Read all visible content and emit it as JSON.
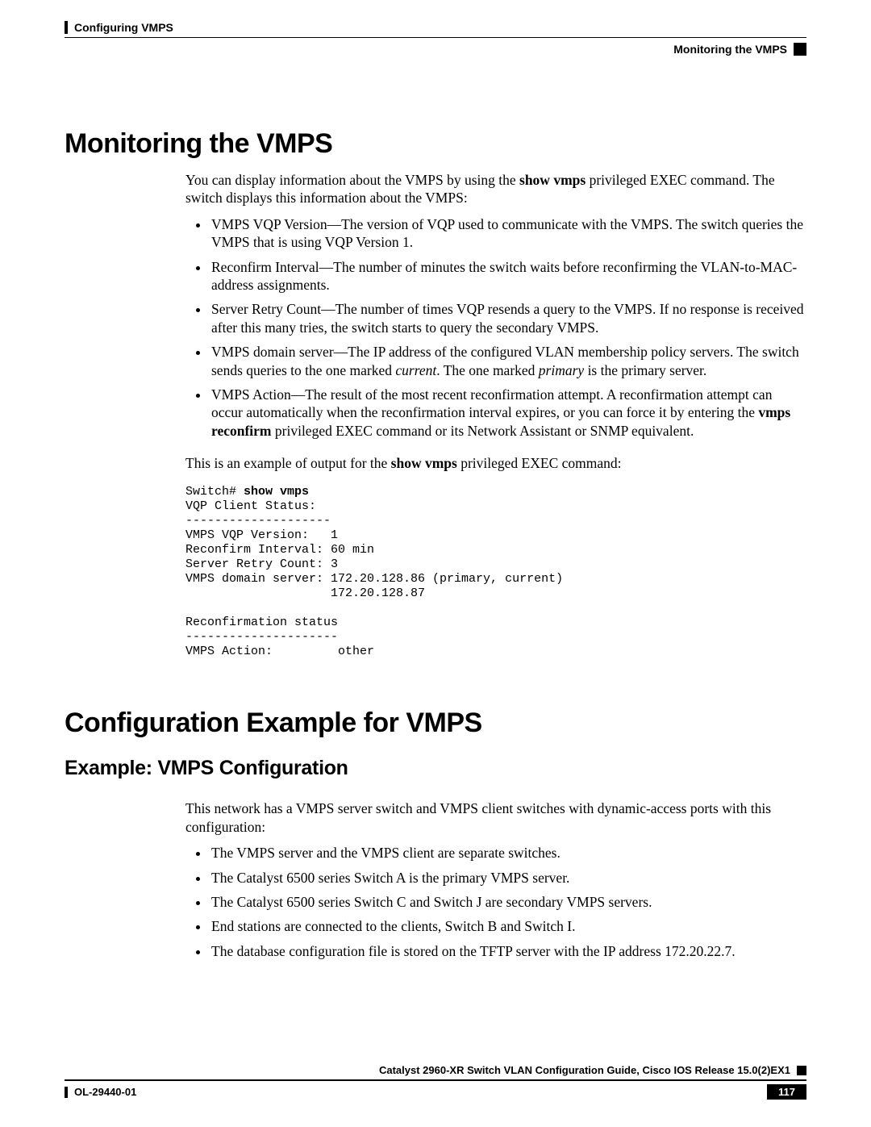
{
  "header": {
    "chapter": "Configuring VMPS",
    "section_right": "Monitoring the VMPS"
  },
  "s1": {
    "title": "Monitoring the VMPS",
    "intro_a": "You can display information about the VMPS by using the ",
    "intro_cmd": "show vmps",
    "intro_b": " privileged EXEC command. The switch displays this information about the VMPS:",
    "bullets": {
      "b1": "VMPS VQP Version—The version of VQP used to communicate with the VMPS. The switch queries the VMPS that is using VQP Version 1.",
      "b2": "Reconfirm Interval—The number of minutes the switch waits before reconfirming the VLAN-to-MAC-address assignments.",
      "b3": "Server Retry Count—The number of times VQP resends a query to the VMPS. If no response is received after this many tries, the switch starts to query the secondary VMPS.",
      "b4a": "VMPS domain server—The IP address of the configured VLAN membership policy servers. The switch sends queries to the one marked ",
      "b4i1": "current",
      "b4b": ". The one marked ",
      "b4i2": "primary",
      "b4c": " is the primary server.",
      "b5a": "VMPS Action—The result of the most recent reconfirmation attempt. A reconfirmation attempt can occur automatically when the reconfirmation interval expires, or you can force it by entering the ",
      "b5cmd": "vmps reconfirm",
      "b5b": " privileged EXEC command or its Network Assistant or SNMP equivalent."
    },
    "example_lead_a": "This is an example of output for the ",
    "example_cmd": "show vmps",
    "example_lead_b": " privileged EXEC command:",
    "cli": {
      "prompt": "Switch# ",
      "cmd": "show vmps",
      "l1": "VQP Client Status:",
      "l2": "--------------------",
      "l3": "VMPS VQP Version:   1",
      "l4": "Reconfirm Interval: 60 min",
      "l5": "Server Retry Count: 3",
      "l6": "VMPS domain server: 172.20.128.86 (primary, current)",
      "l7": "                    172.20.128.87",
      "l8": "",
      "l9": "Reconfirmation status",
      "l10": "---------------------",
      "l11": "VMPS Action:         other"
    }
  },
  "s2": {
    "title": "Configuration Example for VMPS",
    "subtitle": "Example: VMPS Configuration",
    "intro": "This network has a VMPS server switch and VMPS client switches with dynamic-access ports with this configuration:",
    "bullets": {
      "b1": "The VMPS server and the VMPS client are separate switches.",
      "b2": "The Catalyst 6500 series Switch A is the primary VMPS server.",
      "b3": "The Catalyst 6500 series Switch C and Switch J are secondary VMPS servers.",
      "b4": "End stations are connected to the clients, Switch B and Switch I.",
      "b5": "The database configuration file is stored on the TFTP server with the IP address 172.20.22.7."
    }
  },
  "footer": {
    "publication": "Catalyst 2960-XR Switch VLAN Configuration Guide, Cisco IOS Release 15.0(2)EX1",
    "doc_id": "OL-29440-01",
    "page": "117"
  }
}
